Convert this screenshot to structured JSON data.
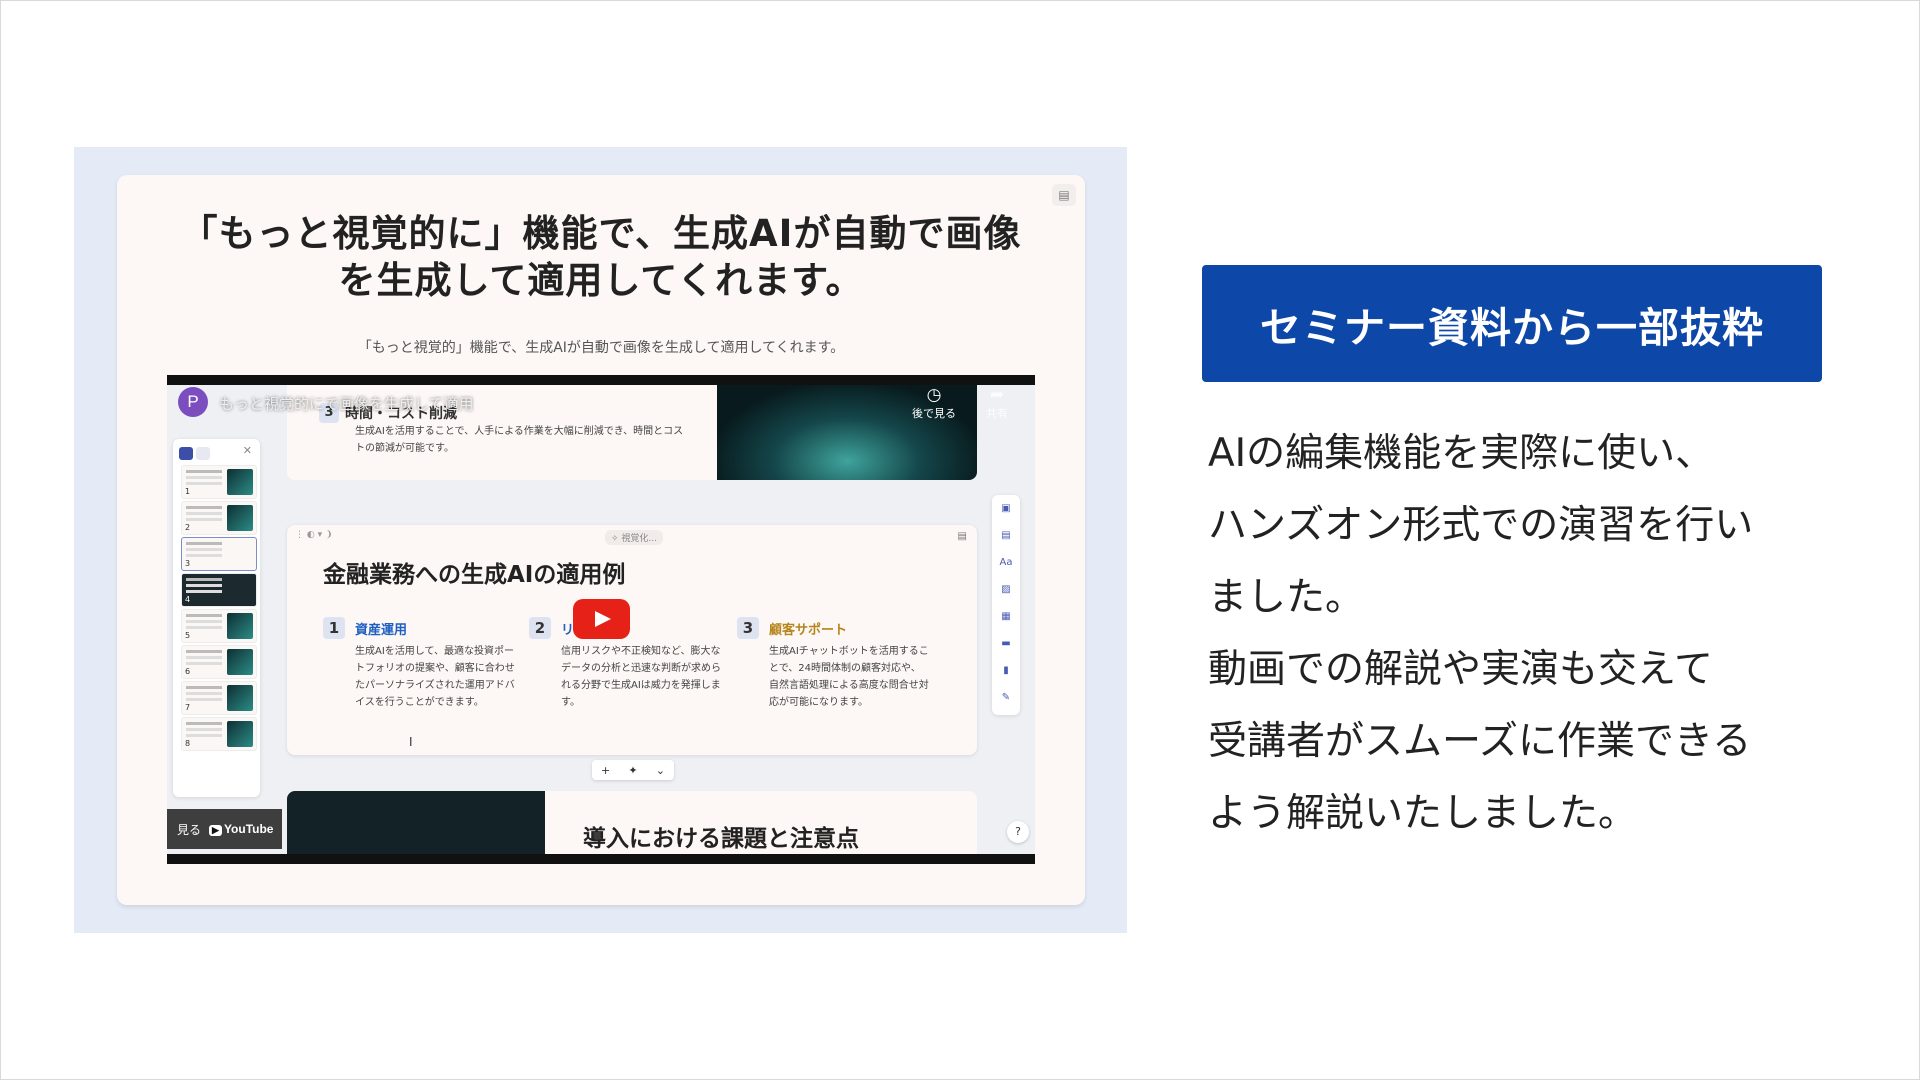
{
  "left": {
    "card_title_line1": "「もっと視覚的に」機能で、生成AIが自動で画像",
    "card_title_line2": "を生成して適用してくれます。",
    "card_subtitle": "「もっと視覚的」機能で、生成AIが自動で画像を生成して適用してくれます。",
    "doc_icon": "document-icon"
  },
  "video": {
    "channel_initial": "P",
    "title": "もっと視覚的にで画像を生成して適用",
    "watch_later": "後で見る",
    "share": "共有",
    "watch_on": "見る",
    "youtube": "YouTube",
    "help": "?",
    "thumbnails": [
      "1",
      "2",
      "3",
      "4",
      "5",
      "6",
      "7",
      "8"
    ],
    "slide1": {
      "num": "3",
      "heading": "時間・コスト削減",
      "text": "生成AIを活用することで、人手による作業を大幅に削減でき、時間とコストの節減が可能です。"
    },
    "slide2": {
      "toolbar": "⋮  ◐ ▾  ❩",
      "chip": "✧ 視覚化...",
      "heading": "金融業務への生成AIの適用例",
      "columns": [
        {
          "num": "1",
          "title": "資産運用",
          "color": "#1d5fc2",
          "text": "生成AIを活用して、最適な投資ポートフォリオの提案や、顧客に合わせたパーソナライズされた運用アドバイスを行うことができます。"
        },
        {
          "num": "2",
          "title": "リスク管理",
          "color": "#1d5fc2",
          "text": "信用リスクや不正検知など、膨大なデータの分析と迅速な判断が求められる分野で生成AIは威力を発揮します。"
        },
        {
          "num": "3",
          "title": "顧客サポート",
          "color": "#b5851b",
          "text": "生成AIチャットボットを活用することで、24時間体制の顧客対応や、自然言語処理による高度な問合せ対応が可能になります。"
        }
      ]
    },
    "add_bar": [
      "+",
      "✦",
      "⌄"
    ],
    "right_tools": [
      "▣",
      "▤",
      "Aa",
      "▨",
      "▦",
      "▬",
      "▮",
      "✎"
    ],
    "slide3": {
      "heading": "導入における課題と注意点"
    }
  },
  "right": {
    "badge": "セミナー資料から一部抜粋",
    "desc_lines": [
      "AIの編集機能を実際に使い、",
      "ハンズオン形式での演習を行い",
      "ました。",
      "動画での解説や実演も交えて",
      "受講者がスムーズに作業できる",
      "よう解説いたしました。"
    ]
  }
}
